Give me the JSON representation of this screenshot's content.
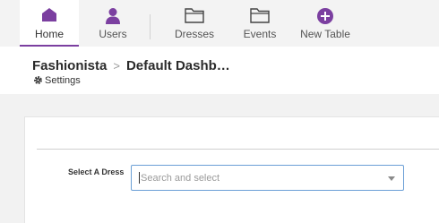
{
  "nav": {
    "items": [
      {
        "label": "Home",
        "icon": "home-icon"
      },
      {
        "label": "Users",
        "icon": "user-icon"
      },
      {
        "label": "Dresses",
        "icon": "folder-icon"
      },
      {
        "label": "Events",
        "icon": "folder-icon"
      },
      {
        "label": "New Table",
        "icon": "plus-circle-icon"
      }
    ],
    "active_index": 0,
    "accent_color": "#7b3fa0"
  },
  "header": {
    "app_name": "Fashionista",
    "separator": ">",
    "page_title": "Default Dashb…",
    "settings_label": "Settings",
    "settings_icon": "gear-icon"
  },
  "form": {
    "select_label": "Select A Dress",
    "select_placeholder": "Search and select",
    "select_value": ""
  }
}
